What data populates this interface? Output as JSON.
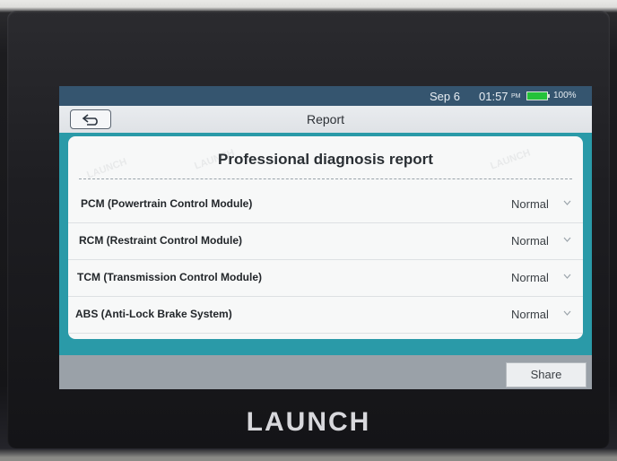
{
  "status_bar": {
    "date": "Sep 6",
    "time": "01:57",
    "meridiem": "PM",
    "battery": "100%"
  },
  "title_bar": {
    "title": "Report"
  },
  "report": {
    "heading": "Professional diagnosis report",
    "rows": [
      {
        "label": "PCM (Powertrain Control Module)",
        "value": "Normal"
      },
      {
        "label": "RCM (Restraint Control Module)",
        "value": "Normal"
      },
      {
        "label": "TCM (Transmission Control Module)",
        "value": "Normal"
      },
      {
        "label": "ABS (Anti-Lock Brake System)",
        "value": "Normal"
      }
    ]
  },
  "bottom_bar": {
    "share_label": "Share"
  },
  "device": {
    "brand": "LAUNCH"
  },
  "colors": {
    "teal": "#2a9aa8",
    "status_bar": "#35556f",
    "battery": "#24c23a"
  }
}
